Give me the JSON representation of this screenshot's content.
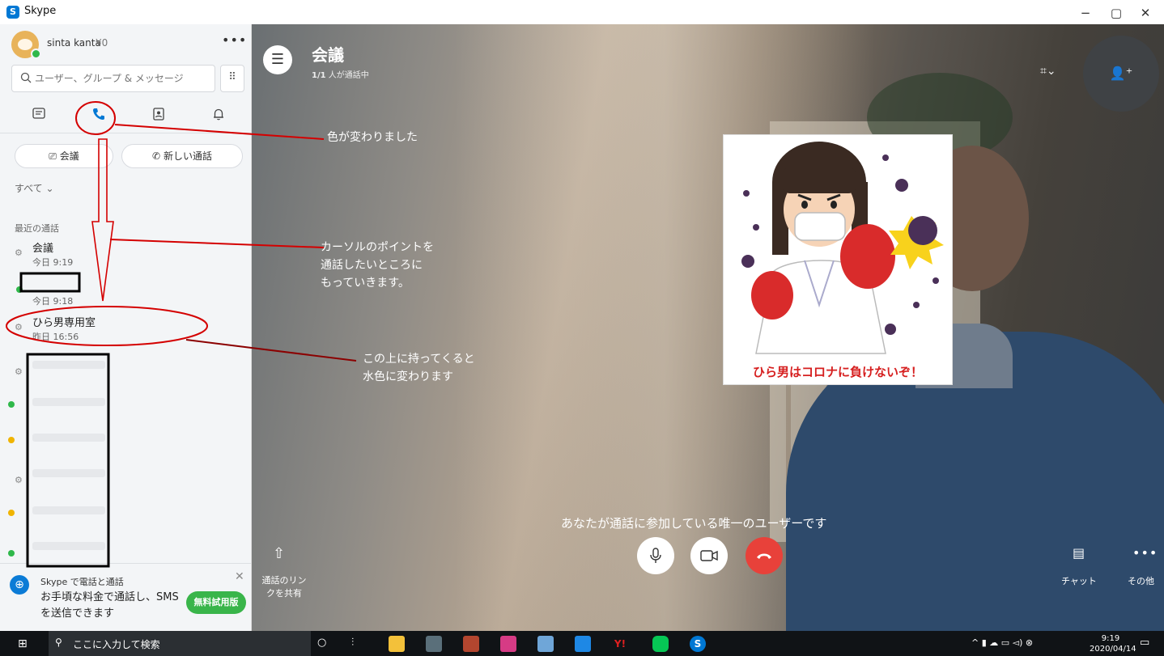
{
  "window": {
    "title": "Skype",
    "minimize": "−",
    "maximize": "▢",
    "close": "✕"
  },
  "profile": {
    "name": "sinta kanta",
    "balance": "¥0",
    "more": "•••"
  },
  "search": {
    "placeholder": "ユーザー、グループ & メッセージ"
  },
  "nav": {
    "chats_icon": "chat-icon",
    "calls_icon": "phone-icon",
    "contacts_icon": "contacts-icon",
    "notifications_icon": "bell-icon"
  },
  "actions": {
    "meeting": "会議",
    "new_call": "新しい通話"
  },
  "filter": {
    "label": "すべて"
  },
  "recent": {
    "heading": "最近の通話",
    "items": [
      {
        "name": "会議",
        "time": "今日 9:19"
      },
      {
        "name": "",
        "time": "今日 9:18"
      },
      {
        "name": "ひら男専用室",
        "time": "昨日 16:56"
      }
    ]
  },
  "promo": {
    "title": "Skype で電話と通話",
    "text": "お手頃な料金で通話し、SMS を送信できます",
    "button": "無料試用版"
  },
  "call": {
    "title": "会議",
    "count": "1/1",
    "subtitle": "人が通話中",
    "status": "あなたが通話に参加している唯一のユーザーです",
    "share_label": "通話のリンクを共有",
    "chat_label": "チャット",
    "more_label": "その他"
  },
  "sticker": {
    "caption": "ひら男はコロナに負けないぞ！"
  },
  "annotations": {
    "color_changed": "色が変わりました",
    "cursor_line1": "カーソルのポイントを",
    "cursor_line2": "通話したいところに",
    "cursor_line3": "もっていきます。",
    "hover_line1": "この上に持ってくると",
    "hover_line2": "水色に変わります"
  },
  "taskbar": {
    "search_placeholder": "ここに入力して検索",
    "time": "9:19",
    "date": "2020/04/14"
  },
  "colors": {
    "accent": "#0078d4",
    "annotation": "#d40000",
    "hangup": "#e8413a",
    "trial": "#39b54a"
  }
}
